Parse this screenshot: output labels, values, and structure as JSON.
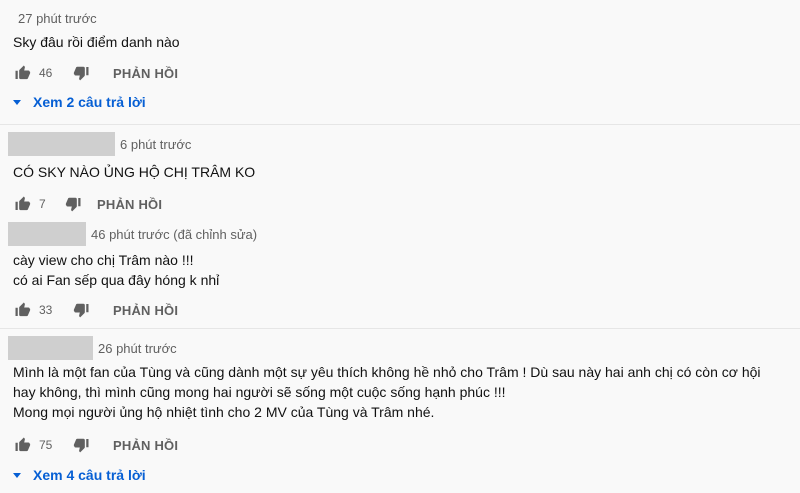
{
  "comments": [
    {
      "time": "27 phút trước",
      "text": "Sky đâu rồi điểm danh nào",
      "likes": "46",
      "reply_label": "PHẢN HỒI",
      "view_replies": "Xem 2 câu trả lời"
    },
    {
      "time": "6 phút trước",
      "text": "CÓ SKY NÀO ỦNG HỘ CHỊ TRÂM KO",
      "likes": "7",
      "reply_label": "PHẢN HỒI"
    },
    {
      "time": "46 phút trước (đã chỉnh sửa)",
      "text": "cày view cho chị Trâm nào !!!\ncó ai Fan sếp qua đây hóng k nhỉ",
      "likes": "33",
      "reply_label": "PHẢN HỒI"
    },
    {
      "time": "26 phút trước",
      "text": "Mình là một fan của Tùng và cũng dành một sự yêu thích không hề nhỏ cho Trâm ! Dù sau này hai anh chị có còn cơ hội\nhay không, thì mình cũng mong hai người sẽ sống một cuộc sống hạnh phúc !!!\nMong mọi người ủng hộ nhiệt tình cho 2 MV của Tùng và Trâm nhé.",
      "likes": "75",
      "reply_label": "PHẢN HỒI",
      "view_replies": "Xem 4 câu trả lời"
    }
  ],
  "colors": {
    "link": "#065fd4",
    "meta": "#606060",
    "placeholder": "#cfcfcf"
  },
  "icons": {
    "like": "thumbs-up-icon",
    "dislike": "thumbs-down-icon",
    "expand": "caret-down-icon"
  }
}
